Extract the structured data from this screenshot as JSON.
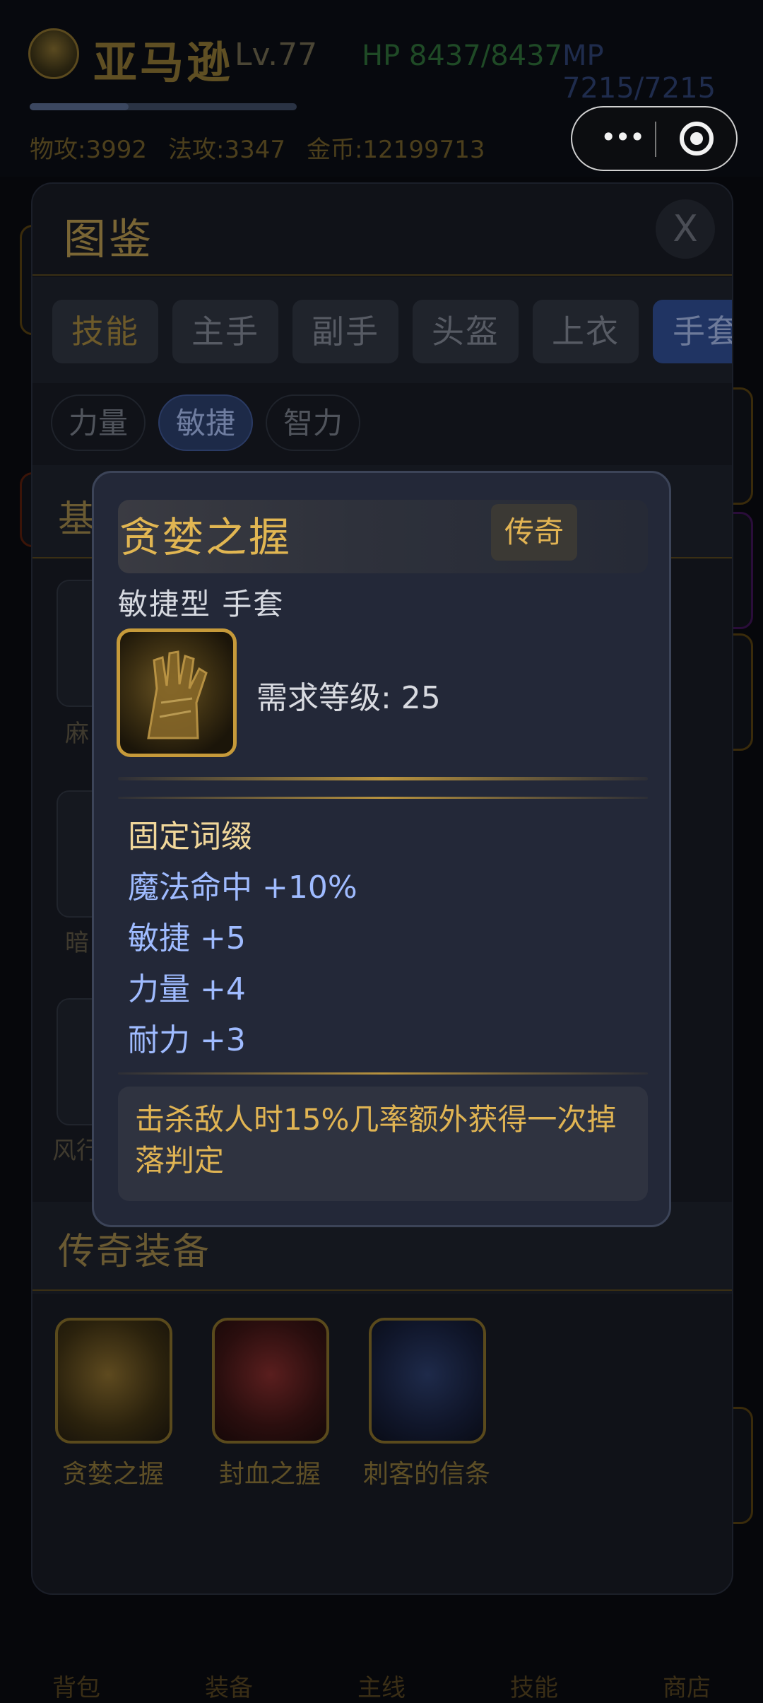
{
  "player": {
    "name": "亚马逊",
    "level": "Lv.77",
    "hp": "HP 8437/8437",
    "mp": "MP 7215/7215",
    "xp_fraction": 0.37,
    "atk": "物攻:3992",
    "matk": "法攻:3347",
    "gold": "金币:12199713"
  },
  "capsule": {
    "more": "•••",
    "target": "target"
  },
  "dialog": {
    "title": "图鉴",
    "close": "X",
    "tabs": [
      "技能",
      "主手",
      "副手",
      "头盔",
      "上衣",
      "手套"
    ],
    "active_tab": "手套",
    "filters": [
      "力量",
      "敏捷",
      "智力"
    ],
    "active_filter": "敏捷",
    "section_basic": "基",
    "basic_labels": [
      "麻",
      "暗",
      "风行"
    ],
    "section_legend": "传奇装备",
    "legend_items": [
      {
        "label": "贪婪之握",
        "icon": "golden-gauntlet-icon"
      },
      {
        "label": "封血之握",
        "icon": "blood-gauntlet-icon"
      },
      {
        "label": "刺客的信条",
        "icon": "assassin-blade-icon"
      }
    ]
  },
  "tooltip": {
    "name": "贪婪之握",
    "rarity": "传奇",
    "type": "敏捷型 手套",
    "requirement": "需求等级: 25",
    "affix_header": "固定词缀",
    "affixes": [
      "魔法命中 +10%",
      "敏捷 +5",
      "力量 +4",
      "耐力 +3"
    ],
    "description": "击杀敌人时15%几率额外获得一次掉落判定"
  },
  "bottom_nav": [
    "背包",
    "装备",
    "主线",
    "技能",
    "商店"
  ],
  "colors": {
    "legend_gold": "#e1b652",
    "affix_blue": "#9fbbff",
    "active_tab": "#203463"
  }
}
